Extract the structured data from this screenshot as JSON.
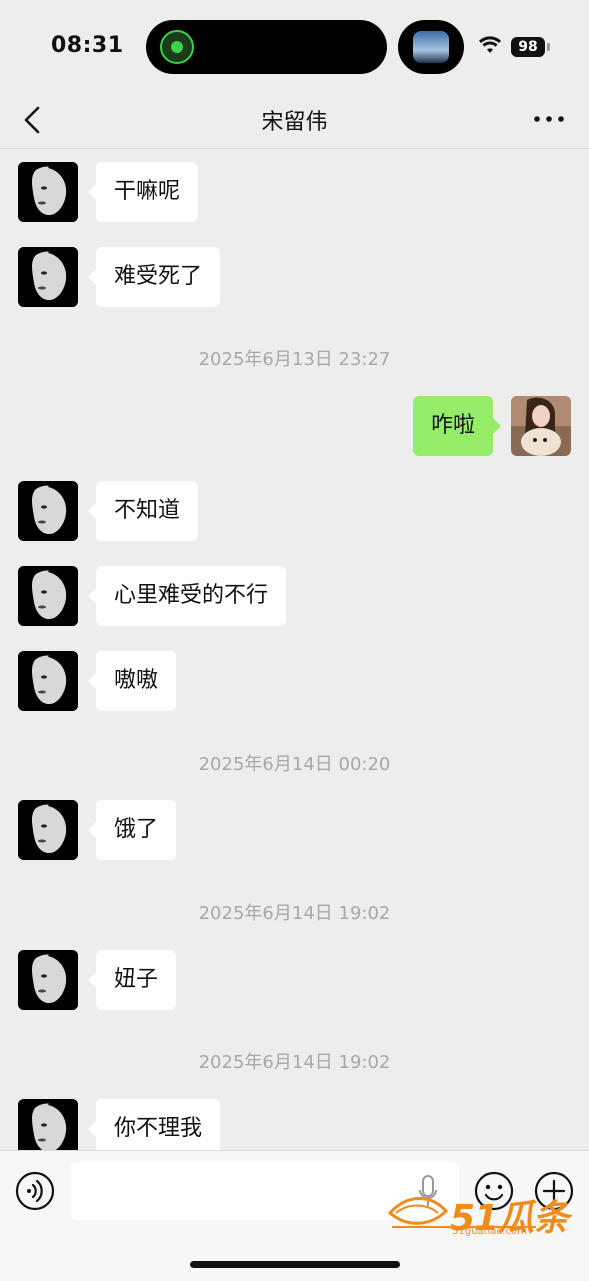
{
  "status_bar": {
    "time": "08:31",
    "battery": "98"
  },
  "header": {
    "title": "宋留伟"
  },
  "messages": {
    "m1": "干嘛呢",
    "m2": "难受死了",
    "t1": "2025年6月13日 23:27",
    "m3": "咋啦",
    "m4": "不知道",
    "m5": "心里难受的不行",
    "m6": "嗷嗷",
    "t2": "2025年6月14日 00:20",
    "m7": "饿了",
    "t3": "2025年6月14日 19:02",
    "m8": "妞子",
    "t4": "2025年6月14日 19:02",
    "m9": "你不理我"
  },
  "watermark": {
    "brand": "51瓜条",
    "url": "51guatiao.com"
  },
  "colors": {
    "sent_bubble": "#95ec69",
    "received_bubble": "#ffffff",
    "background": "#ededed",
    "watermark": "#f08c1c"
  }
}
